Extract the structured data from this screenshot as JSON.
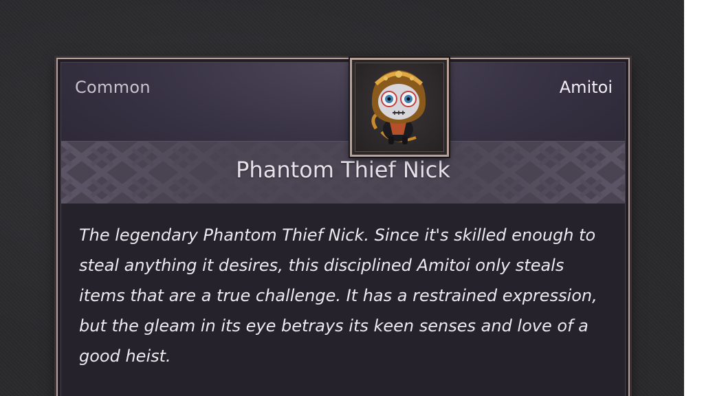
{
  "item": {
    "rarity": "Common",
    "category": "Amitoi",
    "name": "Phantom Thief Nick",
    "description": "The legendary Phantom Thief Nick. Since it's skilled enough to steal anything it desires, this disciplined Amitoi only steals items that are a true challenge. It has a restrained expression, but the gleam in its eye betrays its keen senses and love of a good heist.",
    "portrait_icon": "amitoi-portrait-icon"
  },
  "colors": {
    "frame": "#b8a39b",
    "background": "#2a2a2d",
    "card": "#25222c",
    "name_band": "#4a4452"
  }
}
